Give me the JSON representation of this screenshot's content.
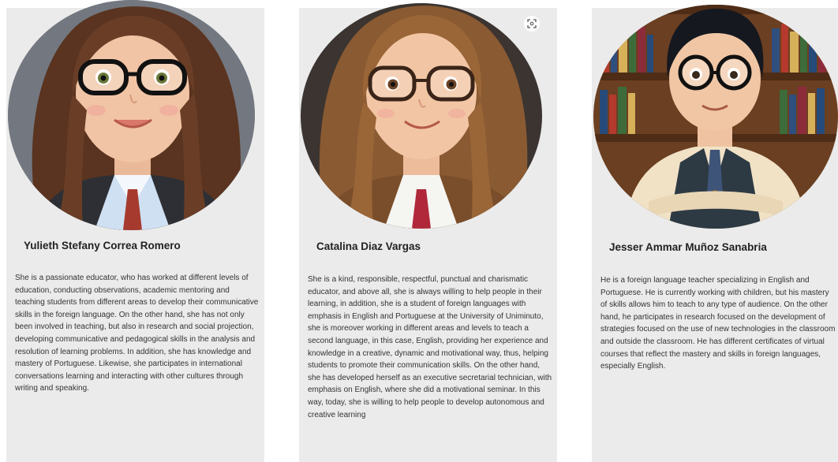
{
  "cards": [
    {
      "name": "Yulieth Stefany Correa Romero",
      "bio": "She is a passionate educator, who has worked at different levels of education, conducting observations, academic mentoring and teaching students from different areas to develop their communicative skills in the foreign language. On the other hand, she has not only been involved in teaching, but also in research and social projection, developing communicative and pedagogical skills in the analysis and resolution of learning problems. In addition, she has knowledge and mastery of Portuguese. Likewise, she participates in international conversations learning and interacting with other cultures through writing and speaking."
    },
    {
      "name": "Catalina Diaz Vargas",
      "bio": "She is a kind, responsible, respectful, punctual and charismatic educator, and above all, she is always willing to help people in their learning, in addition, she is a student of foreign languages with emphasis in English and Portuguese at the University of Uniminuto, she is moreover working in different areas and levels to teach a second language, in this case, English, providing her experience and knowledge in a creative, dynamic and motivational way, thus, helping students to promote their communication skills. On the other hand, she has developed herself as an executive secretarial technician, with emphasis on English, where she did a motivational seminar. In this way, today, she is willing to help people to develop autonomous and creative learning"
    },
    {
      "name": "Jesser Ammar Muñoz Sanabria",
      "bio": "He is a foreign language teacher specializing in English and Portuguese. He is currently working with children, but his mastery of skills allows him to teach to any type of audience. On the other hand, he participates in research focused on the development of strategies focused on the use of new technologies in the classroom and outside the classroom. He has different certificates of virtual courses that reflect the mastery and skills in foreign languages, especially English."
    }
  ],
  "icons": {
    "expand": "expand-icon"
  },
  "colors": {
    "card_background": "#ebebeb",
    "name_text": "#222222",
    "bio_text": "#333333"
  }
}
